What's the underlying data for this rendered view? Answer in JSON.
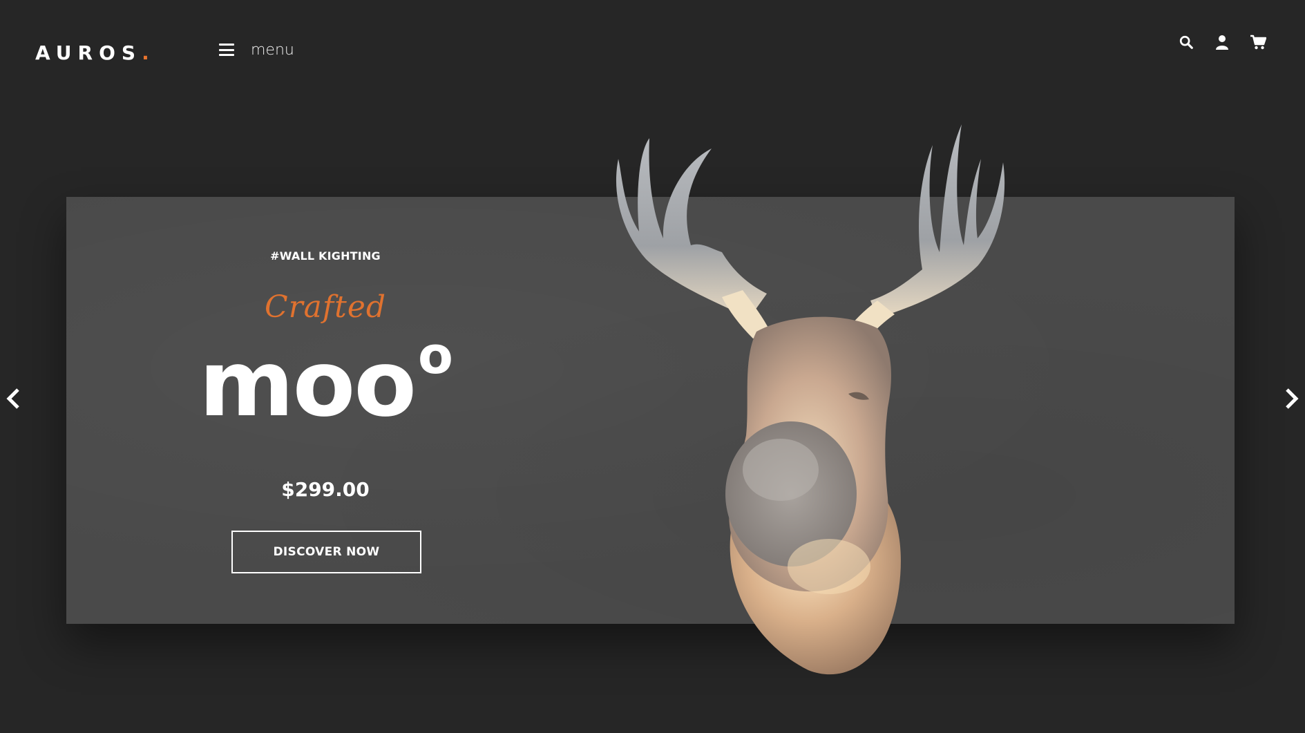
{
  "header": {
    "logo_text": "AUROS",
    "logo_dot": ".",
    "menu_label": "menu",
    "icons": [
      "search-icon",
      "user-icon",
      "cart-icon"
    ]
  },
  "hero": {
    "hashtag": "#WALL KIGHTING",
    "script_text": "Crafted",
    "product_name": "moo",
    "product_superscript": "o",
    "price": "$299.00",
    "cta_label": "DISCOVER NOW"
  },
  "slider": {
    "prev_icon": "chevron-left-icon",
    "next_icon": "chevron-right-icon"
  },
  "colors": {
    "background": "#262626",
    "panel": "#4a4a4a",
    "accent": "#e0722f",
    "text": "#ffffff"
  }
}
